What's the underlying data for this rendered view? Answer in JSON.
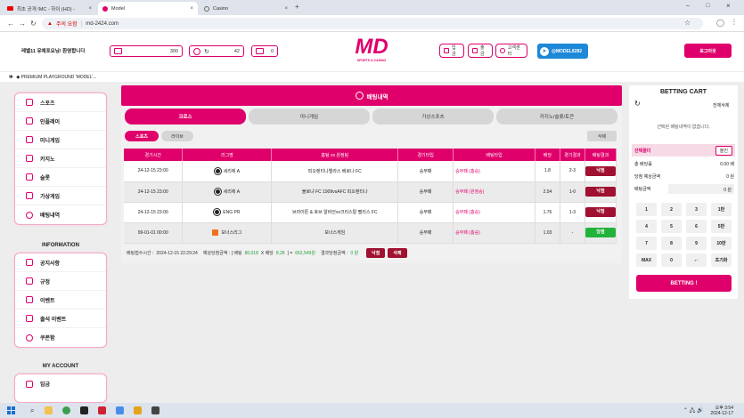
{
  "browser": {
    "tabs": [
      {
        "label": "최초 공개 !MC - 하이 (HD) -"
      },
      {
        "label": "Model"
      },
      {
        "label": "Casino"
      }
    ],
    "url_badge": "주의 요함",
    "url": "md-2424.com"
  },
  "header": {
    "welcome": "레벨11 유예포요님! 환영합니다",
    "balance": "300",
    "points": "42",
    "messages": "0",
    "logo_text": "MD",
    "logo_sub": "SPORTS & CASINO",
    "buttons": [
      "입금",
      "출금",
      "고객센터"
    ],
    "telegram": "@MODEL8282",
    "logout": "로그아웃"
  },
  "ticker": "◆ PREMIUM PLAYGROUND 'MODEL'...",
  "sidebar": {
    "menu": [
      "스포츠",
      "인플레이",
      "미니게임",
      "카지노",
      "슬롯",
      "가상게임",
      "배팅내역"
    ],
    "info_heading": "INFORMATION",
    "info": [
      "공지사항",
      "규정",
      "이벤트",
      "출석 이벤트",
      "쿠폰함"
    ],
    "account_heading": "MY ACCOUNT",
    "account": [
      "입금"
    ]
  },
  "main": {
    "title": "배팅내역",
    "categories": [
      "크로스",
      "미니게임",
      "가상스포츠",
      "카지노/슬롯/토큰"
    ],
    "subtabs": [
      "스포츠",
      "라이브"
    ],
    "delete_label": "삭제",
    "columns": [
      "경기시간",
      "리그명",
      "홈팀 vs 원정팀",
      "경기타입",
      "배팅타입",
      "배당",
      "경기결과",
      "배팅결과"
    ],
    "rows": [
      {
        "time": "24-12-15 23:00",
        "league": "세리에 A",
        "match": "피오렌티나엘라스 베로나 FC",
        "type": "승무패",
        "pick": "승무패 (홈승)",
        "odds": "1.8",
        "score": "2-3",
        "result": "낙첨"
      },
      {
        "time": "24-12-15 23:00",
        "league": "세리에 A",
        "match": "볼로냐 FC 1909vsAFC 피오렌티나",
        "type": "승무패",
        "pick": "승무패 (원정승)",
        "odds": "2.54",
        "score": "1-0",
        "result": "낙첨"
      },
      {
        "time": "24-12-15 23:00",
        "league": "ENG PR",
        "match": "브라이튼 & 호브 알비언vs크리스탈 팰리스 FC",
        "type": "승무패",
        "pick": "승무패 (홈승)",
        "odds": "1.76",
        "score": "1-3",
        "result": "낙첨"
      },
      {
        "time": "99-01-01 00:00",
        "league": "보너스리그",
        "match": "보너스게임",
        "type": "승무패",
        "pick": "승무패 (홈승)",
        "odds": "1.03",
        "score": "-",
        "result": "당첨"
      }
    ],
    "summary": {
      "date_label": "배팅접수시간 :",
      "date": "2024-12-15 22:29:24",
      "expected_label": "예상당첨금액 : [ 배팅",
      "bet": "80,018",
      "x": "X 배당",
      "odds": "8.28",
      "arrow": "] =",
      "expected": "662,549원",
      "win_label": "결과당첨금액 :",
      "win": "0 원",
      "result_btn": "낙첨",
      "delete_btn": "삭제"
    }
  },
  "cart": {
    "title": "BETTING CART",
    "delete_all": "전체삭제",
    "empty": "선택된 배팅내역이 없습니다.",
    "select_label": "선택폴더",
    "select_btn": "올인",
    "odds_label": "총 배당률",
    "odds_value": "0.00 배",
    "win_label": "당첨 예상금액",
    "win_value": "0 원",
    "bet_label": "배팅금액",
    "bet_value": "0 원",
    "keys": [
      "1",
      "2",
      "3",
      "1만",
      "4",
      "5",
      "6",
      "5만",
      "7",
      "8",
      "9",
      "10만",
      "MAX",
      "0",
      "←",
      "초기화"
    ],
    "submit": "BETTING !"
  },
  "taskbar": {
    "time": "오후 3:54",
    "date": "2024-12-17"
  },
  "colors": {
    "accent": "#e0006b",
    "lose": "#a01030",
    "win": "#22b33a"
  }
}
